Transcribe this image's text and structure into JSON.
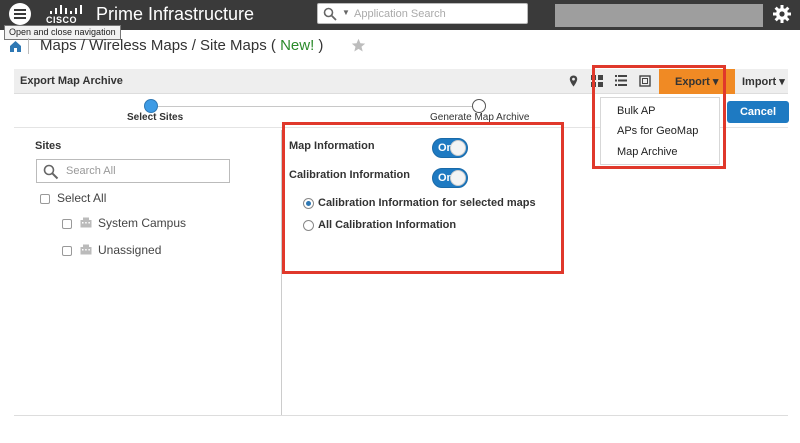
{
  "app": {
    "brand": "CISCO",
    "product": "Prime Infrastructure",
    "search_placeholder": "Application Search",
    "menu_tooltip": "Open and close navigation"
  },
  "breadcrumb": {
    "path": "Maps / Wireless Maps / Site Maps ( ",
    "new_badge": "New!",
    "close_paren": " )"
  },
  "toolbar": {
    "title": "Export Map Archive",
    "export_label": "Export ▾",
    "import_label": "Import ▾"
  },
  "export_menu": {
    "items": [
      "Bulk AP",
      "APs for GeoMap",
      "Map Archive"
    ]
  },
  "stepper": {
    "steps": [
      "Select Sites",
      "Generate Map Archive"
    ],
    "active_step": 0
  },
  "actions": {
    "cancel": "Cancel"
  },
  "sites": {
    "heading": "Sites",
    "search_placeholder": "Search All",
    "select_all": "Select All",
    "items": [
      "System Campus",
      "Unassigned"
    ]
  },
  "options": {
    "map_information": "Map Information",
    "calibration_information": "Calibration Information",
    "toggle_on": "On",
    "radio_selected_maps": "Calibration Information for selected maps",
    "radio_all": "All Calibration Information",
    "selected_radio": 0
  },
  "colors": {
    "topbar": "#3a3a3a",
    "accent_orange": "#f08a24",
    "primary_blue": "#1e7ac2",
    "highlight_red": "#e0382b",
    "new_green": "#2a8a2a"
  }
}
